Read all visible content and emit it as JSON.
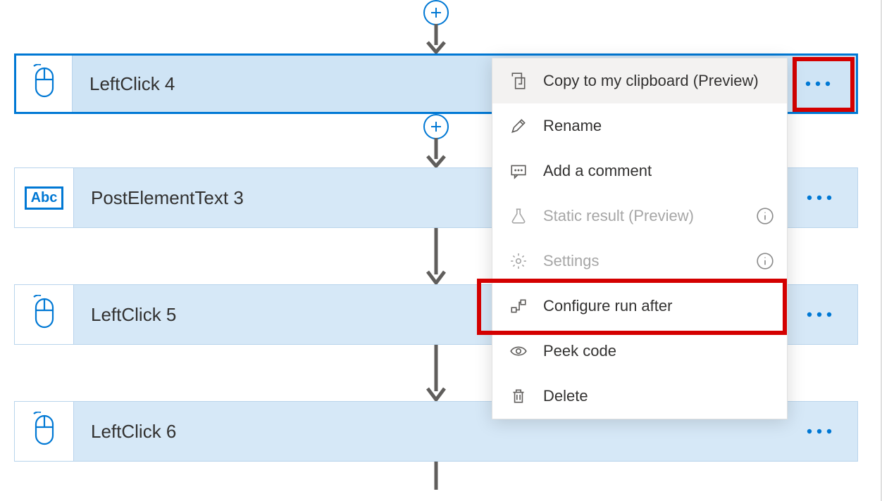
{
  "steps": [
    {
      "label": "LeftClick 4",
      "icon": "mouse"
    },
    {
      "label": "PostElementText 3",
      "icon": "abc"
    },
    {
      "label": "LeftClick 5",
      "icon": "mouse"
    },
    {
      "label": "LeftClick 6",
      "icon": "mouse"
    }
  ],
  "menu": {
    "copy": "Copy to my clipboard (Preview)",
    "rename": "Rename",
    "add_comment": "Add a comment",
    "static": "Static result (Preview)",
    "settings": "Settings",
    "run_after": "Configure run after",
    "peek": "Peek code",
    "delete": "Delete"
  },
  "abc_text": "Abc"
}
